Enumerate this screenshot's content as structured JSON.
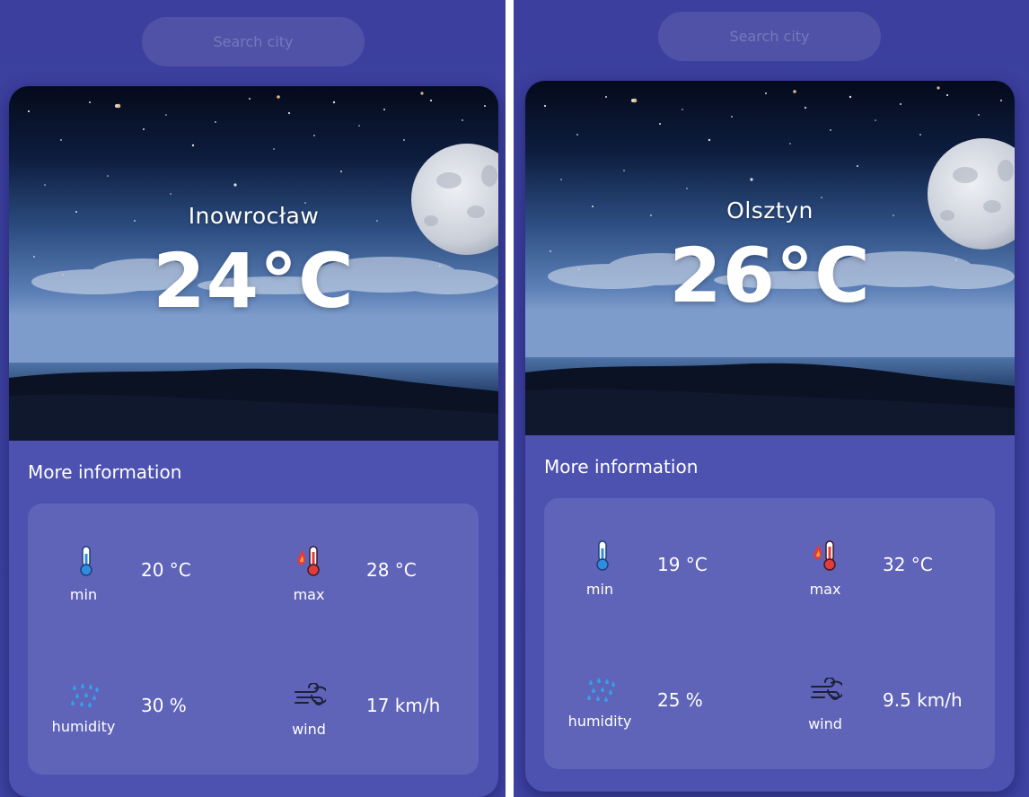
{
  "panels": [
    {
      "search": {
        "placeholder": "Search city"
      },
      "city": "Inowrocław",
      "temperature": "24°C",
      "more_title": "More information",
      "stats": {
        "min": {
          "label": "min",
          "value": "20 °C",
          "icon": "thermometer-cold-icon"
        },
        "max": {
          "label": "max",
          "value": "28 °C",
          "icon": "thermometer-hot-icon"
        },
        "humidity": {
          "label": "humidity",
          "value": "30 %",
          "icon": "rain-drops-icon"
        },
        "wind": {
          "label": "wind",
          "value": "17 km/h",
          "icon": "wind-icon"
        }
      }
    },
    {
      "search": {
        "placeholder": "Search city"
      },
      "city": "Olsztyn",
      "temperature": "26°C",
      "more_title": "More information",
      "stats": {
        "min": {
          "label": "min",
          "value": "19 °C",
          "icon": "thermometer-cold-icon"
        },
        "max": {
          "label": "max",
          "value": "32 °C",
          "icon": "thermometer-hot-icon"
        },
        "humidity": {
          "label": "humidity",
          "value": "25 %",
          "icon": "rain-drops-icon"
        },
        "wind": {
          "label": "wind",
          "value": "9.5 km/h",
          "icon": "wind-icon"
        }
      }
    }
  ],
  "colors": {
    "page_background": "#3d40a0",
    "card": "#4d51b0",
    "info_box": "#5f64b8",
    "text": "#ffffff",
    "thermometer_cold": "#2f8de0",
    "thermometer_hot": "#e23b3b",
    "rain": "#35a0ea"
  }
}
